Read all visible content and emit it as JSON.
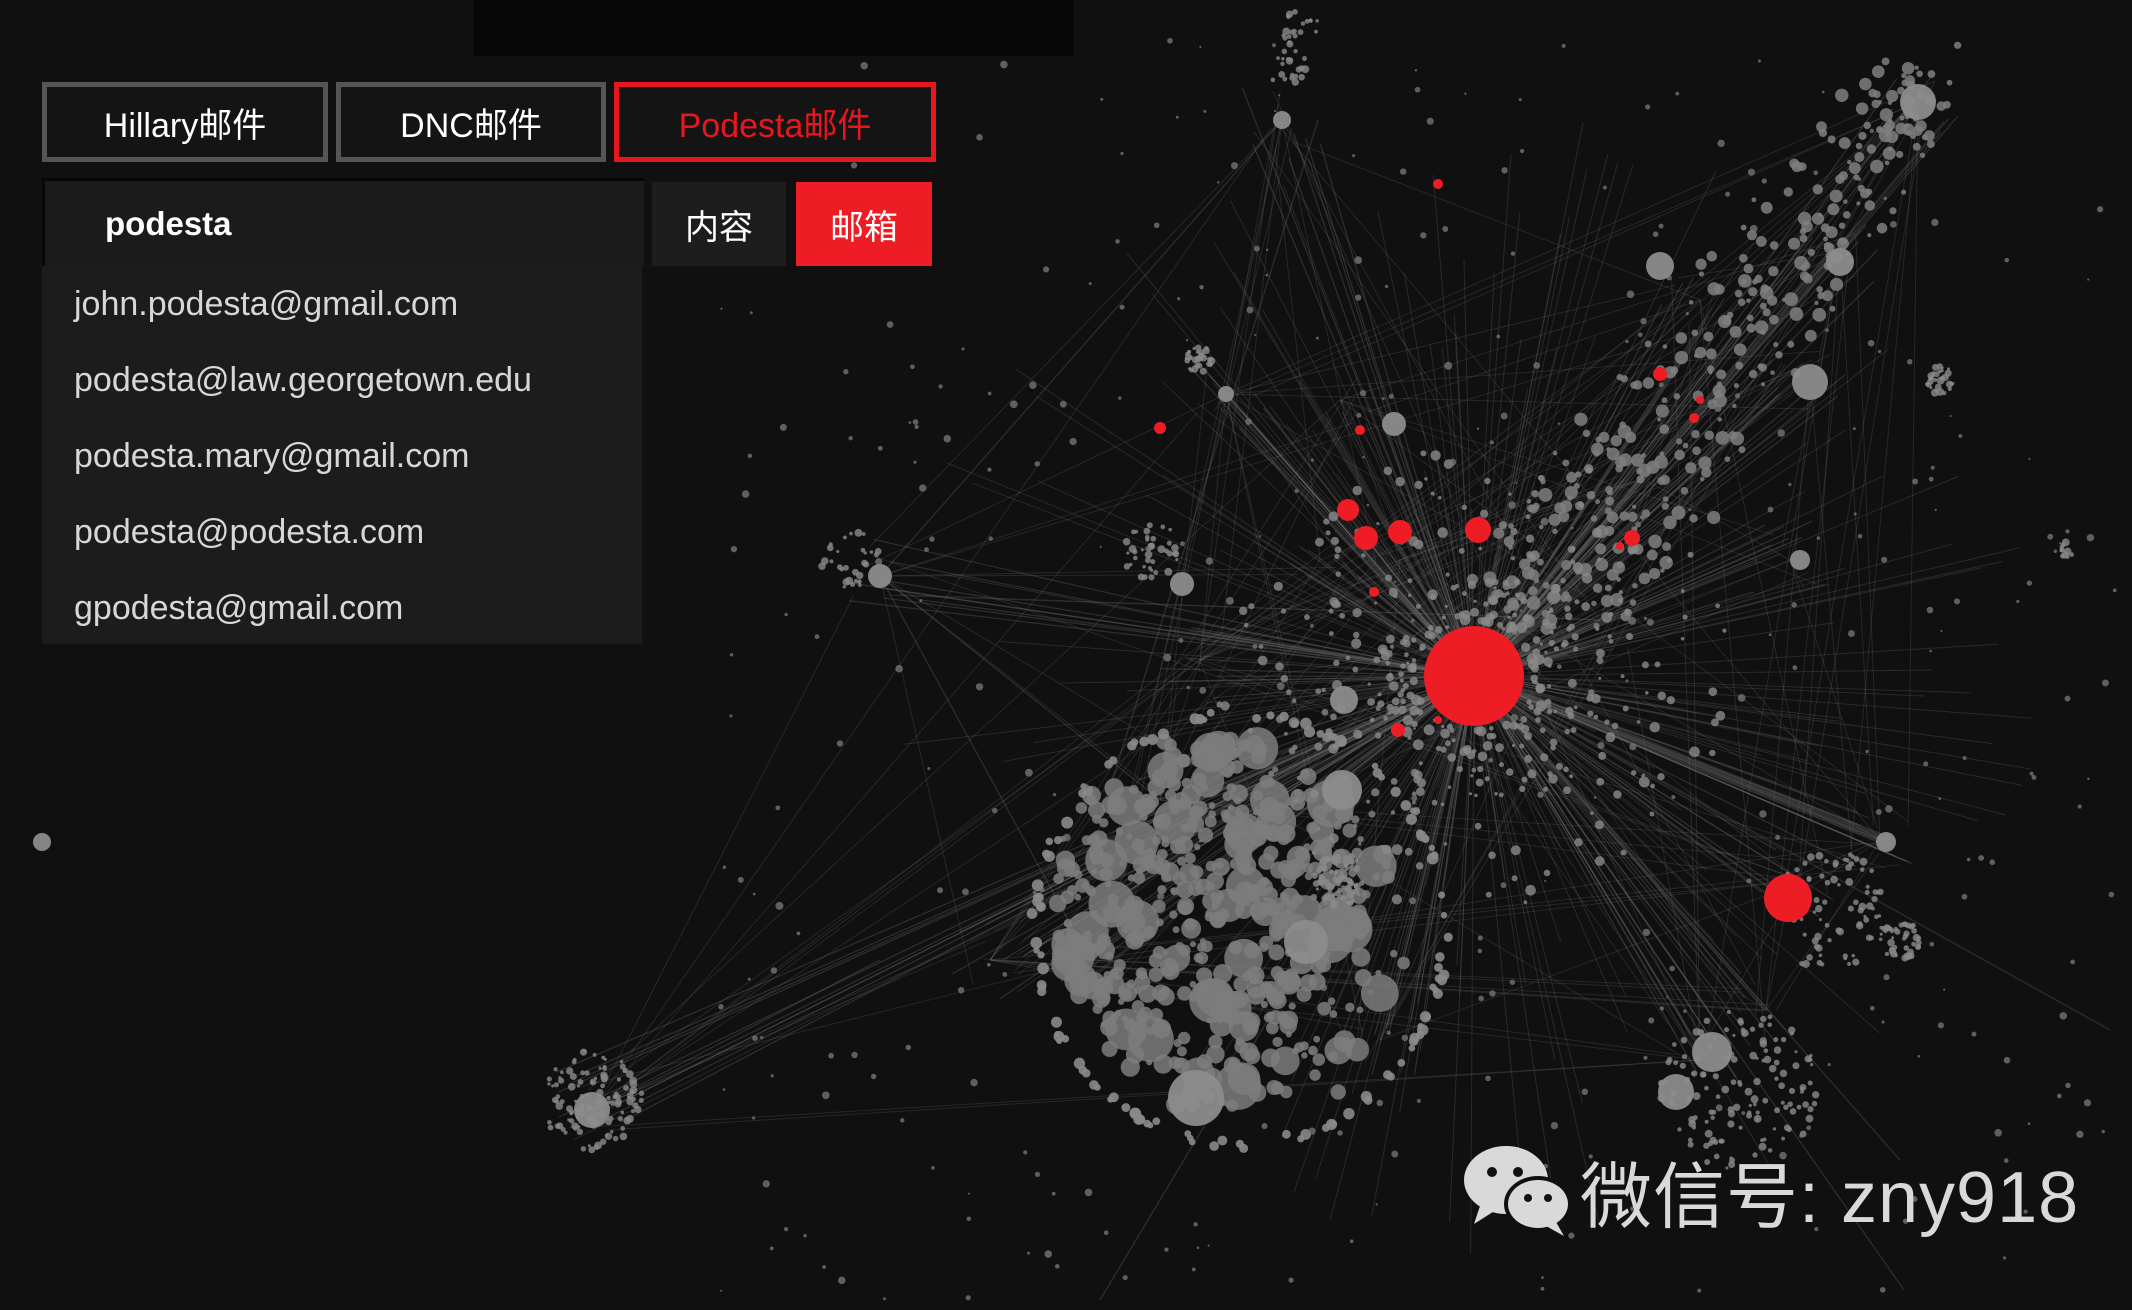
{
  "tabs": {
    "hillary": "Hillary邮件",
    "dnc": "DNC邮件",
    "podesta": "Podesta邮件"
  },
  "search": {
    "value": "podesta"
  },
  "modes": {
    "content": "内容",
    "mailbox": "邮箱"
  },
  "suggestions": [
    "john.podesta@gmail.com",
    "podesta@law.georgetown.edu",
    "podesta.mary@gmail.com",
    "podesta@podesta.com",
    "gpodesta@gmail.com"
  ],
  "watermark": {
    "text": "微信号: zny918"
  },
  "colors": {
    "background": "#101010",
    "accent": "#ee1c25",
    "node": "#8c8c8c",
    "edge": "#6a6a6a"
  },
  "icons": {
    "watermark": "wechat-icon"
  }
}
